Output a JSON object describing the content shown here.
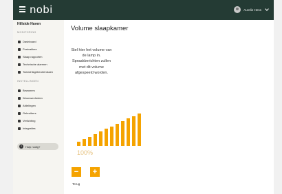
{
  "header": {
    "logo": "nobi",
    "user_name": "Aurelie Hens"
  },
  "sidebar": {
    "organization": "Hillside Haven",
    "monitoring_label": "MONITORING",
    "monitoring_items": [
      {
        "label": "Dashboard",
        "icon": "dashboard-icon"
      },
      {
        "label": "Postvakken",
        "icon": "mailbox-icon"
      },
      {
        "label": "Slaap rapporten",
        "icon": "sleep-report-icon"
      },
      {
        "label": "Technische alarmen",
        "icon": "technical-alarm-icon"
      },
      {
        "label": "Toezichtsgebeurtenissen",
        "icon": "supervision-icon"
      }
    ],
    "settings_label": "INSTELLINGEN",
    "settings_items": [
      {
        "label": "Bewoners",
        "icon": "residents-icon"
      },
      {
        "label": "Woonwenheden",
        "icon": "residences-icon"
      },
      {
        "label": "Afdelingen",
        "icon": "departments-icon"
      },
      {
        "label": "Gebruikers",
        "icon": "users-icon"
      },
      {
        "label": "Verlichting",
        "icon": "lighting-icon"
      },
      {
        "label": "Integraties",
        "icon": "integrations-icon"
      }
    ],
    "help_label": "Hulp nodig?"
  },
  "main": {
    "title": "Volume slaapkamer",
    "description": "Stel hier het volume van de lamp in. Spraakberichten zullen met dit volume afgespeeld worden.",
    "volume_level": 1.0,
    "volume_steps": 12,
    "volume_text": "100%",
    "decrease_label": "−",
    "increase_label": "+",
    "back_label": "Terug"
  },
  "colors": {
    "topbar": "#243b34",
    "accent": "#f5a300",
    "sidebar_bg": "#f6f5f1"
  }
}
